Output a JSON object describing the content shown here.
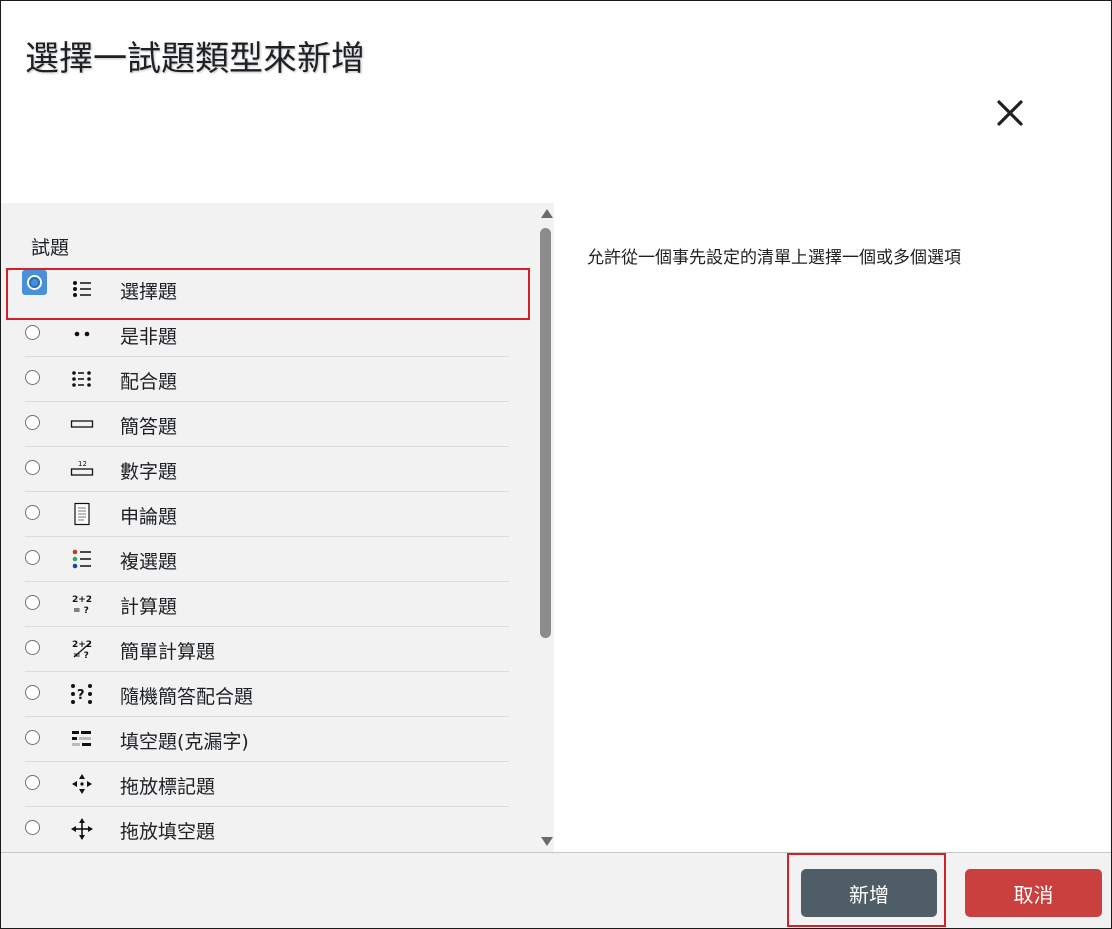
{
  "dialog": {
    "title": "選擇一試題類型來新增",
    "close_icon": "close-icon"
  },
  "left_panel": {
    "section_label": "試題",
    "items": [
      {
        "label": "選擇題",
        "icon": "multichoice-icon",
        "selected": true
      },
      {
        "label": "是非題",
        "icon": "truefalse-icon",
        "selected": false
      },
      {
        "label": "配合題",
        "icon": "match-icon",
        "selected": false
      },
      {
        "label": "簡答題",
        "icon": "shortanswer-icon",
        "selected": false
      },
      {
        "label": "數字題",
        "icon": "numerical-icon",
        "selected": false
      },
      {
        "label": "申論題",
        "icon": "essay-icon",
        "selected": false
      },
      {
        "label": "複選題",
        "icon": "multiple-select-icon",
        "selected": false
      },
      {
        "label": "計算題",
        "icon": "calculated-icon",
        "selected": false
      },
      {
        "label": "簡單計算題",
        "icon": "calculated-simple-icon",
        "selected": false
      },
      {
        "label": "隨機簡答配合題",
        "icon": "random-sa-match-icon",
        "selected": false
      },
      {
        "label": "填空題(克漏字)",
        "icon": "cloze-icon",
        "selected": false
      },
      {
        "label": "拖放標記題",
        "icon": "drag-drop-markers-icon",
        "selected": false
      },
      {
        "label": "拖放填空題",
        "icon": "drag-drop-text-icon",
        "selected": false
      }
    ]
  },
  "right_panel": {
    "description": "允許從一個事先設定的清單上選擇一個或多個選項"
  },
  "footer": {
    "add_label": "新增",
    "cancel_label": "取消"
  },
  "colors": {
    "add_button": "#4f5d66",
    "cancel_button": "#c9403f",
    "highlight": "#d0222a",
    "selected_radio": "#4a90d9"
  }
}
